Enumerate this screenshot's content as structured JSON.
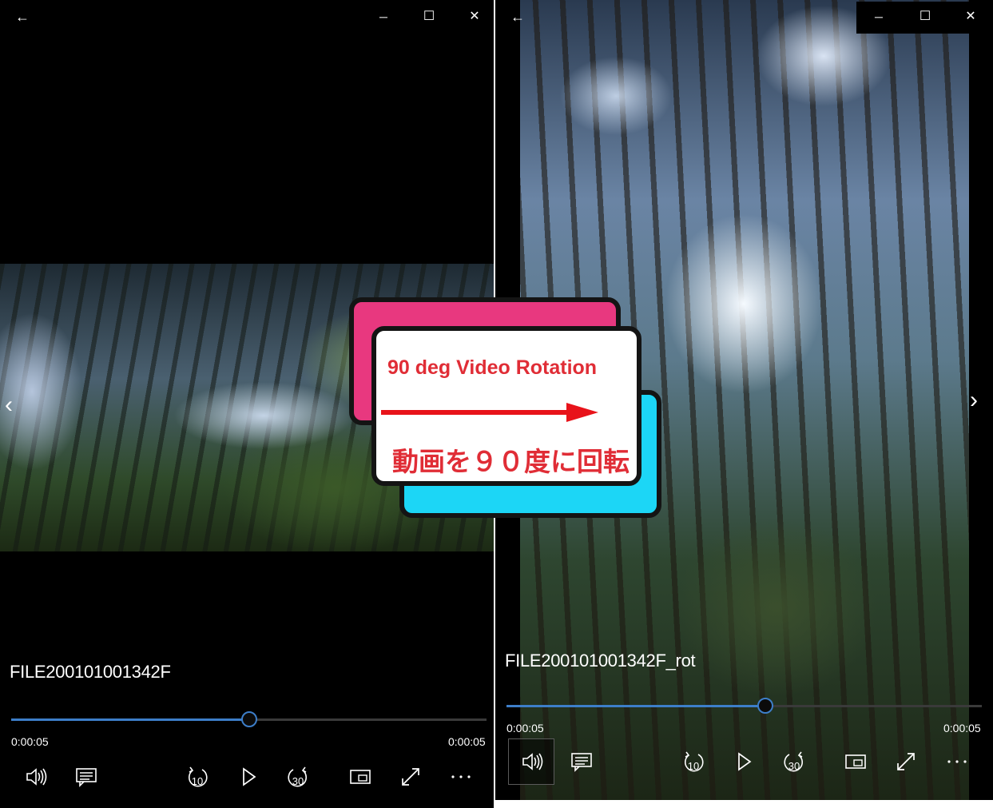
{
  "left_window": {
    "title": "FILE200101001342F",
    "time_current": "0:00:05",
    "time_total": "0:00:05",
    "progress": 0.5
  },
  "right_window": {
    "title": "FILE200101001342F_rot",
    "time_current": "0:00:05",
    "time_total": "0:00:05",
    "progress": 0.544
  },
  "title_bar": {
    "back_glyph": "←",
    "minimize_glyph": "─",
    "maximize_glyph": "☐",
    "close_glyph": "✕"
  },
  "nav": {
    "prev_glyph": "‹",
    "next_glyph": "›"
  },
  "controls": {
    "rewind_label": "10",
    "forward_label": "30",
    "more_glyph": "···"
  },
  "overlay": {
    "english": "90 deg Video Rotation",
    "japanese": "動画を９０度に回転",
    "colors": {
      "pink": "#e8387f",
      "cyan": "#1cd6f6",
      "text_red": "#e02d36",
      "arrow_red": "#e8131a"
    }
  },
  "accent_color": "#3d7ec9"
}
